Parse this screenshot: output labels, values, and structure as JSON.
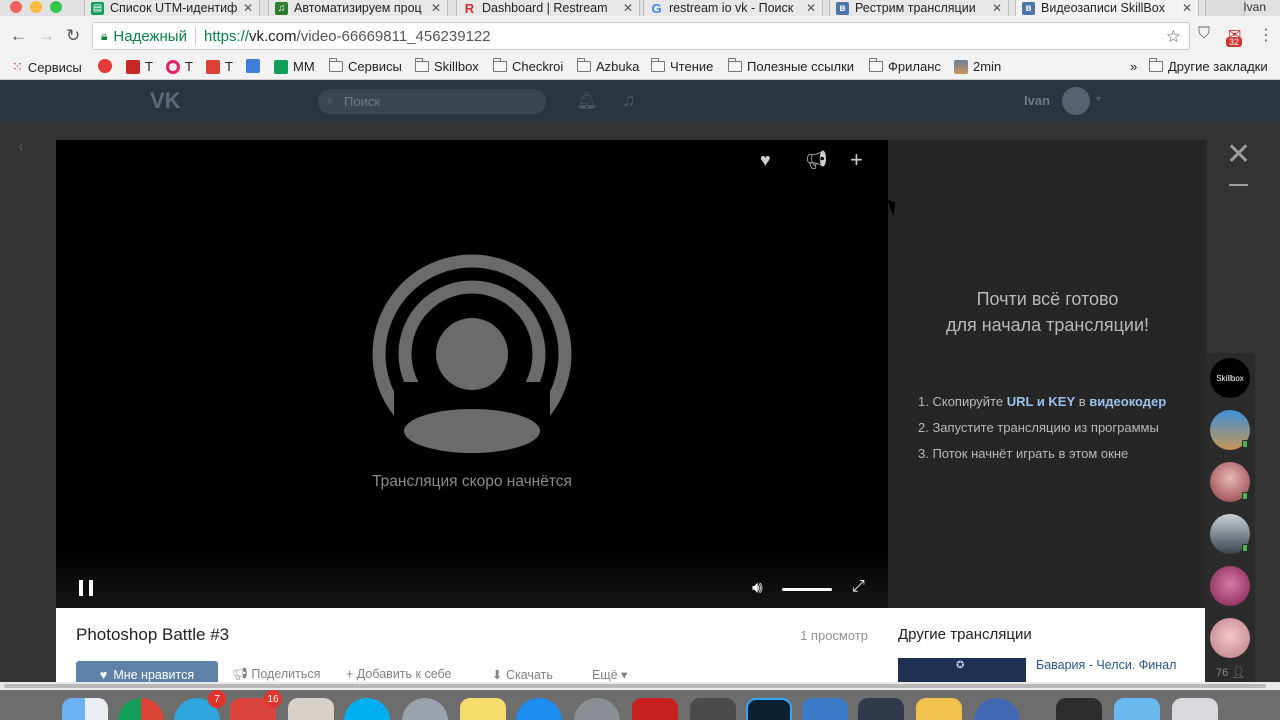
{
  "browser": {
    "tabs": [
      {
        "title": "Список UTM-идентиф",
        "favicon": "sheets-icon",
        "color": "#0f9d58"
      },
      {
        "title": "Автоматизируем проц",
        "favicon": "music-icon",
        "color": "#2e7d32"
      },
      {
        "title": "Dashboard | Restream",
        "favicon": "restream-icon",
        "color": "#d32f2f"
      },
      {
        "title": "restream io vk - Поиск",
        "favicon": "google-icon",
        "color": "#4285f4"
      },
      {
        "title": "Рестрим трансляции",
        "favicon": "vk-icon",
        "color": "#4a76a8"
      },
      {
        "title": "Видеозаписи SkillBox",
        "favicon": "vk-icon",
        "color": "#4a76a8"
      }
    ],
    "profile_name": "Ivan",
    "secure_label": "Надежный",
    "url_scheme": "https://",
    "url_host": "vk.com",
    "url_path": "/video-66669811_456239122",
    "ext_badge": "32"
  },
  "bookmarks": [
    {
      "label": "Сервисы",
      "type": "apps"
    },
    {
      "label": "",
      "type": "tomato"
    },
    {
      "label": "T",
      "type": "bar"
    },
    {
      "label": "T",
      "type": "target"
    },
    {
      "label": "T",
      "type": "todoist"
    },
    {
      "label": "",
      "type": "calendar"
    },
    {
      "label": "MM",
      "type": "sheet"
    },
    {
      "label": "Сервисы",
      "type": "folder"
    },
    {
      "label": "Skillbox",
      "type": "folder"
    },
    {
      "label": "Checkroi",
      "type": "folder"
    },
    {
      "label": "Azbuka",
      "type": "folder"
    },
    {
      "label": "Чтение",
      "type": "folder"
    },
    {
      "label": "Полезные ссылки",
      "type": "folder"
    },
    {
      "label": "Фриланс",
      "type": "folder"
    },
    {
      "label": "2min",
      "type": "image"
    },
    {
      "label": "»",
      "type": "more"
    },
    {
      "label": "Другие закладки",
      "type": "folder"
    }
  ],
  "vk": {
    "search_placeholder": "Поиск",
    "user_name": "Ivan"
  },
  "player": {
    "status_text": "Трансляция скоро начнётся",
    "icons": [
      "heart-icon",
      "megaphone-icon",
      "plus-icon"
    ],
    "volume": 1.0
  },
  "side": {
    "ready_title_1": "Почти всё готово",
    "ready_title_2": "для начала трансляции!",
    "step1_num": "1.",
    "step1_pre": "Скопируйте ",
    "step1_b1": "URL и KEY",
    "step1_mid": " в ",
    "step1_b2": "видеокодер",
    "step2": "2. Запустите трансляцию из программы",
    "step3": "3. Поток начнёт играть в этом окне"
  },
  "video": {
    "title": "Photoshop Battle #3",
    "views": "1 просмотр",
    "like_label": "Мне нравится",
    "share_label": "Поделиться",
    "add_label": "Добавить к себе",
    "download_label": "Скачать",
    "more_label": "Ещё"
  },
  "others": {
    "title": "Другие трансляции",
    "item1_name": "Бавария - Челси. Финал"
  },
  "friends": {
    "first_label": "Skillbox",
    "count": "76"
  },
  "dock": {
    "telegram_badge": "7",
    "wunderlist_badge": "16"
  },
  "colors": {
    "vk_blue": "#5e81a8",
    "link": "#2a5885",
    "highlight": "#9ac2ec",
    "online": "#4bb34b"
  }
}
